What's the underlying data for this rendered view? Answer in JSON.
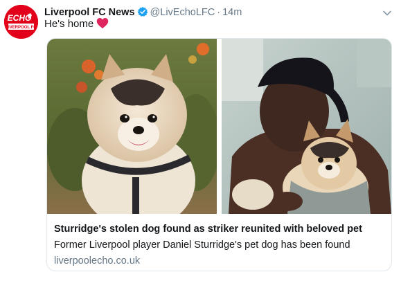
{
  "tweet": {
    "author": {
      "display_name": "Liverpool FC News",
      "handle": "@LivEchoLFC",
      "verified": true,
      "avatar_text_top": "ECHO",
      "avatar_text_bottom": "LIVERPOOL FC"
    },
    "separator": "·",
    "timestamp": "14m",
    "text": "He's home",
    "menu_icon": "chevron-down-icon",
    "emoji_icon": "heart-icon"
  },
  "card": {
    "title": "Sturridge's stolen dog found as striker reunited with beloved pet",
    "description": "Former Liverpool player Daniel Sturridge's pet dog has been found",
    "domain": "liverpoolecho.co.uk"
  },
  "colors": {
    "brand_red": "#e2001a",
    "verified_blue": "#1da1f2",
    "heart_red": "#e0245e",
    "muted": "#657786",
    "border": "#e1e8ed"
  }
}
